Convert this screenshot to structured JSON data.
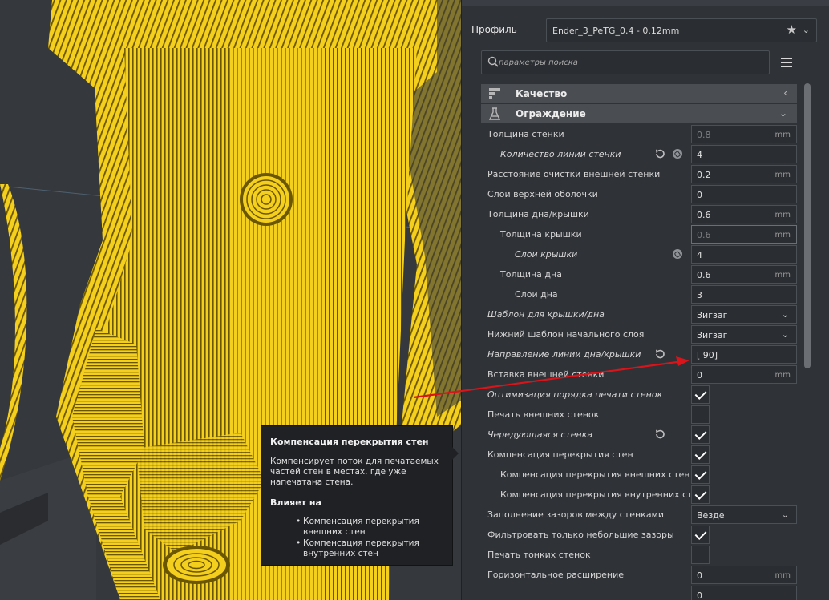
{
  "profile": {
    "label": "Профиль",
    "value": "Ender_3_PeTG_0.4 - 0.12mm",
    "star_icon": "★",
    "chevron_icon": "⌄"
  },
  "search": {
    "placeholder": "параметры поиска"
  },
  "sections": {
    "quality": {
      "title": "Качество",
      "icon": "quality-icon",
      "chevron": "‹"
    },
    "walls": {
      "title": "Ограждение",
      "icon": "walls-icon",
      "chevron": "⌄"
    }
  },
  "settings": [
    {
      "label": "Толщина стенки",
      "value": "0.8",
      "unit": "mm",
      "type": "field",
      "dim": true
    },
    {
      "label": "Количество линий стенки",
      "value": "4",
      "type": "field",
      "italic": true,
      "reset": true,
      "link": true
    },
    {
      "label": "Расстояние очистки внешней стенки",
      "value": "0.2",
      "unit": "mm",
      "type": "field"
    },
    {
      "label": "Слои верхней оболочки",
      "value": "0",
      "type": "field"
    },
    {
      "label": "Толщина дна/крышки",
      "value": "0.6",
      "unit": "mm",
      "type": "field"
    },
    {
      "label": "Толщина крышки",
      "value": "0.6",
      "unit": "mm",
      "type": "field",
      "dim": true,
      "focus": true
    },
    {
      "label": "Слои крышки",
      "value": "4",
      "type": "field",
      "italic": true,
      "link": true
    },
    {
      "label": "Толщина дна",
      "value": "0.6",
      "unit": "mm",
      "type": "field"
    },
    {
      "label": "Слои дна",
      "value": "3",
      "type": "field"
    },
    {
      "label": "Шаблон для крышки/дна",
      "value": "Зигзаг",
      "type": "select",
      "italic": true
    },
    {
      "label": "Нижний шаблон начального слоя",
      "value": "Зигзаг",
      "type": "select"
    },
    {
      "label": "Направление линии дна/крышки",
      "value": "[ 90]",
      "type": "field",
      "italic": true,
      "reset": true
    },
    {
      "label": "Вставка внешней стенки",
      "value": "0",
      "unit": "mm",
      "type": "field"
    },
    {
      "label": "Оптимизация порядка печати стенок",
      "type": "check",
      "checked": true,
      "italic": true
    },
    {
      "label": "Печать внешних стенок",
      "type": "check",
      "checked": false
    },
    {
      "label": "Чередующаяся стенка",
      "type": "check",
      "checked": true,
      "italic": true,
      "reset": true
    },
    {
      "label": "Компенсация перекрытия стен",
      "type": "check",
      "checked": true
    },
    {
      "label": "Компенсация перекрытия внешних стен",
      "type": "check",
      "checked": true
    },
    {
      "label": "Компенсация перекрытия внутренних стен",
      "type": "check",
      "checked": true
    },
    {
      "label": "Заполнение зазоров между стенками",
      "value": "Везде",
      "type": "select"
    },
    {
      "label": "Фильтровать только небольшие зазоры",
      "type": "check",
      "checked": true
    },
    {
      "label": "Печать тонких стенок",
      "type": "check",
      "checked": false
    },
    {
      "label": "Горизонтальное расширение",
      "value": "0",
      "unit": "mm",
      "type": "field"
    },
    {
      "label": "",
      "value": "0",
      "type": "field"
    }
  ],
  "tooltip": {
    "title": "Компенсация перекрытия стен",
    "description": "Компенсирует поток для печатаемых частей стен в местах, где уже напечатана стена.",
    "affects_label": "Влияет на",
    "affects": [
      "Компенсация перекрытия внешних стен",
      "Компенсация перекрытия внутренних стен"
    ]
  },
  "colors": {
    "filament": "#f2cd1b",
    "filament_dark": "#6b5600",
    "annotation_arrow": "#d9141b"
  }
}
